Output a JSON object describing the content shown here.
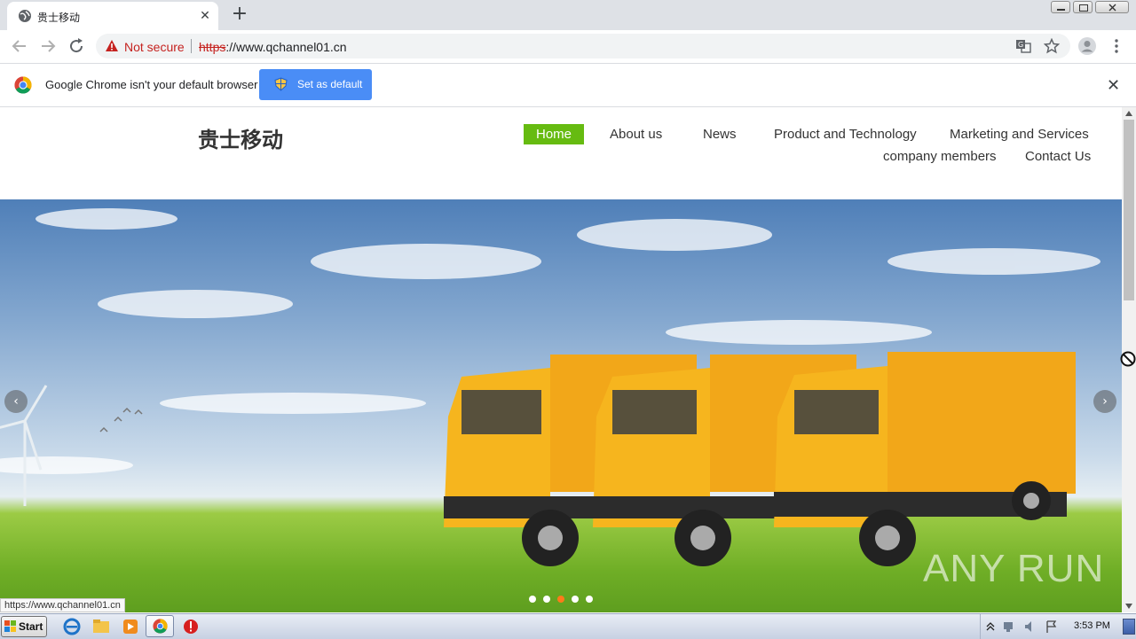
{
  "browser": {
    "tab_title": "贵士移动",
    "new_tab_label": "+",
    "tab_close_label": "✕",
    "security_label": "Not secure",
    "url_protocol": "https",
    "url_rest": "://www.qchannel01.cn"
  },
  "infobar": {
    "message": "Google Chrome isn't your default browser",
    "button_label": "Set as default",
    "close_label": "✕"
  },
  "site": {
    "logo": "贵士移动",
    "nav": [
      {
        "label": "Home"
      },
      {
        "label": "About us"
      },
      {
        "label": "News"
      },
      {
        "label": "Product and Technology"
      },
      {
        "label": "Marketing and Services"
      },
      {
        "label": "company members"
      },
      {
        "label": "Contact Us"
      }
    ],
    "carousel": {
      "prev": "‹",
      "next": "›",
      "slide_count": 5,
      "active_slide": 3
    },
    "watermark": "ANY RUN",
    "accent_color": "#66bb11"
  },
  "status_bar": {
    "hover_url": "https://www.qchannel01.cn"
  },
  "taskbar": {
    "start_label": "Start",
    "clock": "3:53 PM"
  }
}
